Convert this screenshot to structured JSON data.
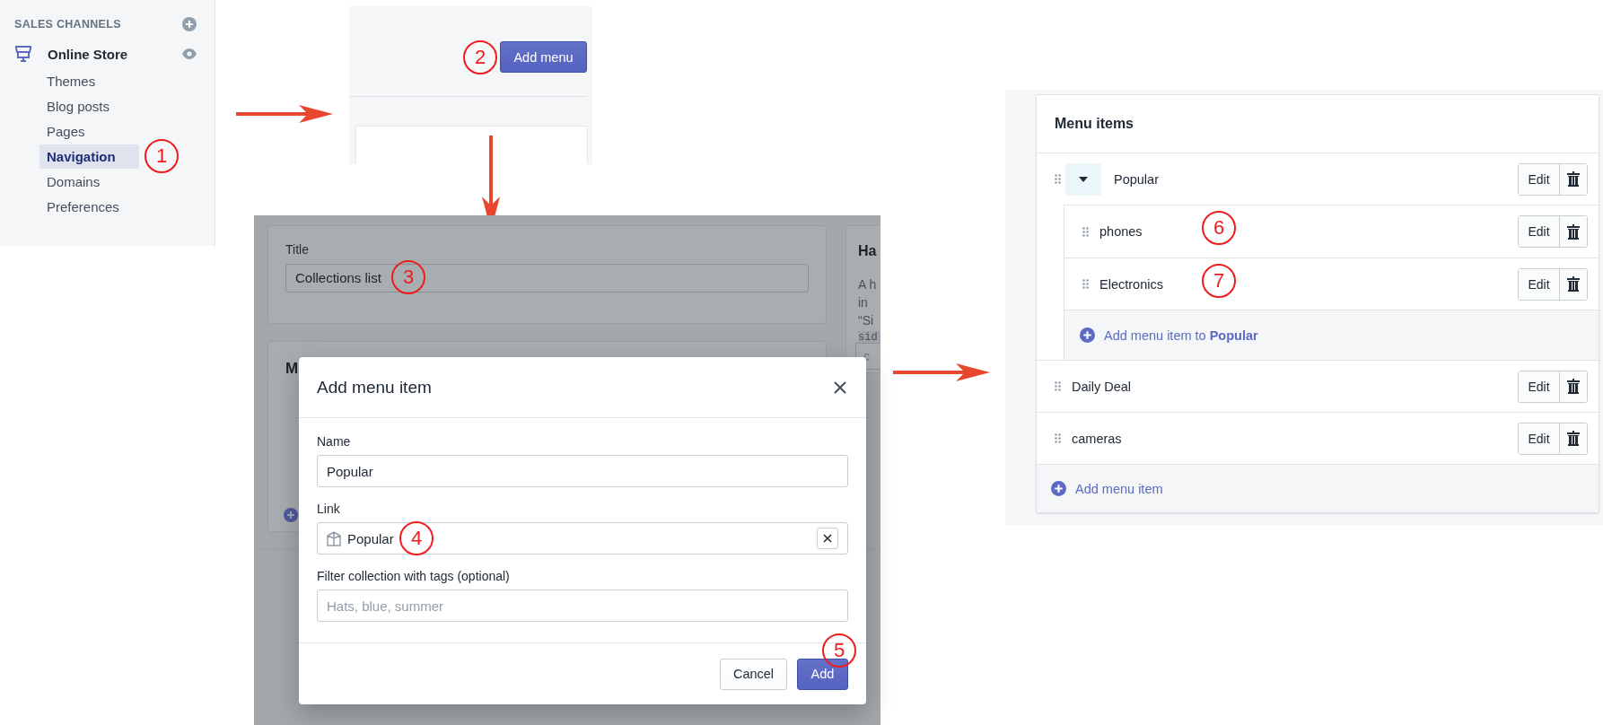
{
  "sidebar": {
    "section_title": "SALES CHANNELS",
    "channel": "Online Store",
    "items": [
      {
        "label": "Themes",
        "selected": false
      },
      {
        "label": "Blog posts",
        "selected": false
      },
      {
        "label": "Pages",
        "selected": false
      },
      {
        "label": "Navigation",
        "selected": true,
        "callout": "1"
      },
      {
        "label": "Domains",
        "selected": false
      },
      {
        "label": "Preferences",
        "selected": false
      }
    ]
  },
  "add_menu_panel": {
    "button": "Add menu",
    "callout": "2"
  },
  "edit_menu_panel": {
    "title_label": "Title",
    "title_value": "Collections list",
    "title_callout": "3",
    "second_card_heading": "M",
    "side_heading": "Ha",
    "side_lines": [
      "A h",
      "in",
      "“Si"
    ],
    "side_code": "sid",
    "side_field": "c"
  },
  "dialog": {
    "title": "Add menu item",
    "fields": [
      {
        "label": "Name",
        "value": "Popular"
      },
      {
        "label": "Link",
        "value": "Popular",
        "callout": "4"
      },
      {
        "label": "Filter collection with tags (optional)",
        "placeholder": "Hats, blue, summer"
      }
    ],
    "cancel": "Cancel",
    "add": "Add",
    "add_callout": "5"
  },
  "menu_items_panel": {
    "title": "Menu items",
    "items": [
      {
        "label": "Popular",
        "expanded": true,
        "edit": "Edit",
        "children": [
          {
            "label": "phones",
            "edit": "Edit",
            "callout": "6"
          },
          {
            "label": "Electronics",
            "edit": "Edit",
            "callout": "7"
          }
        ],
        "add_child": "Add menu item to **Popular**"
      },
      {
        "label": "Daily Deal",
        "edit": "Edit"
      },
      {
        "label": "cameras",
        "edit": "Edit"
      }
    ],
    "add_item": "Add menu item"
  }
}
